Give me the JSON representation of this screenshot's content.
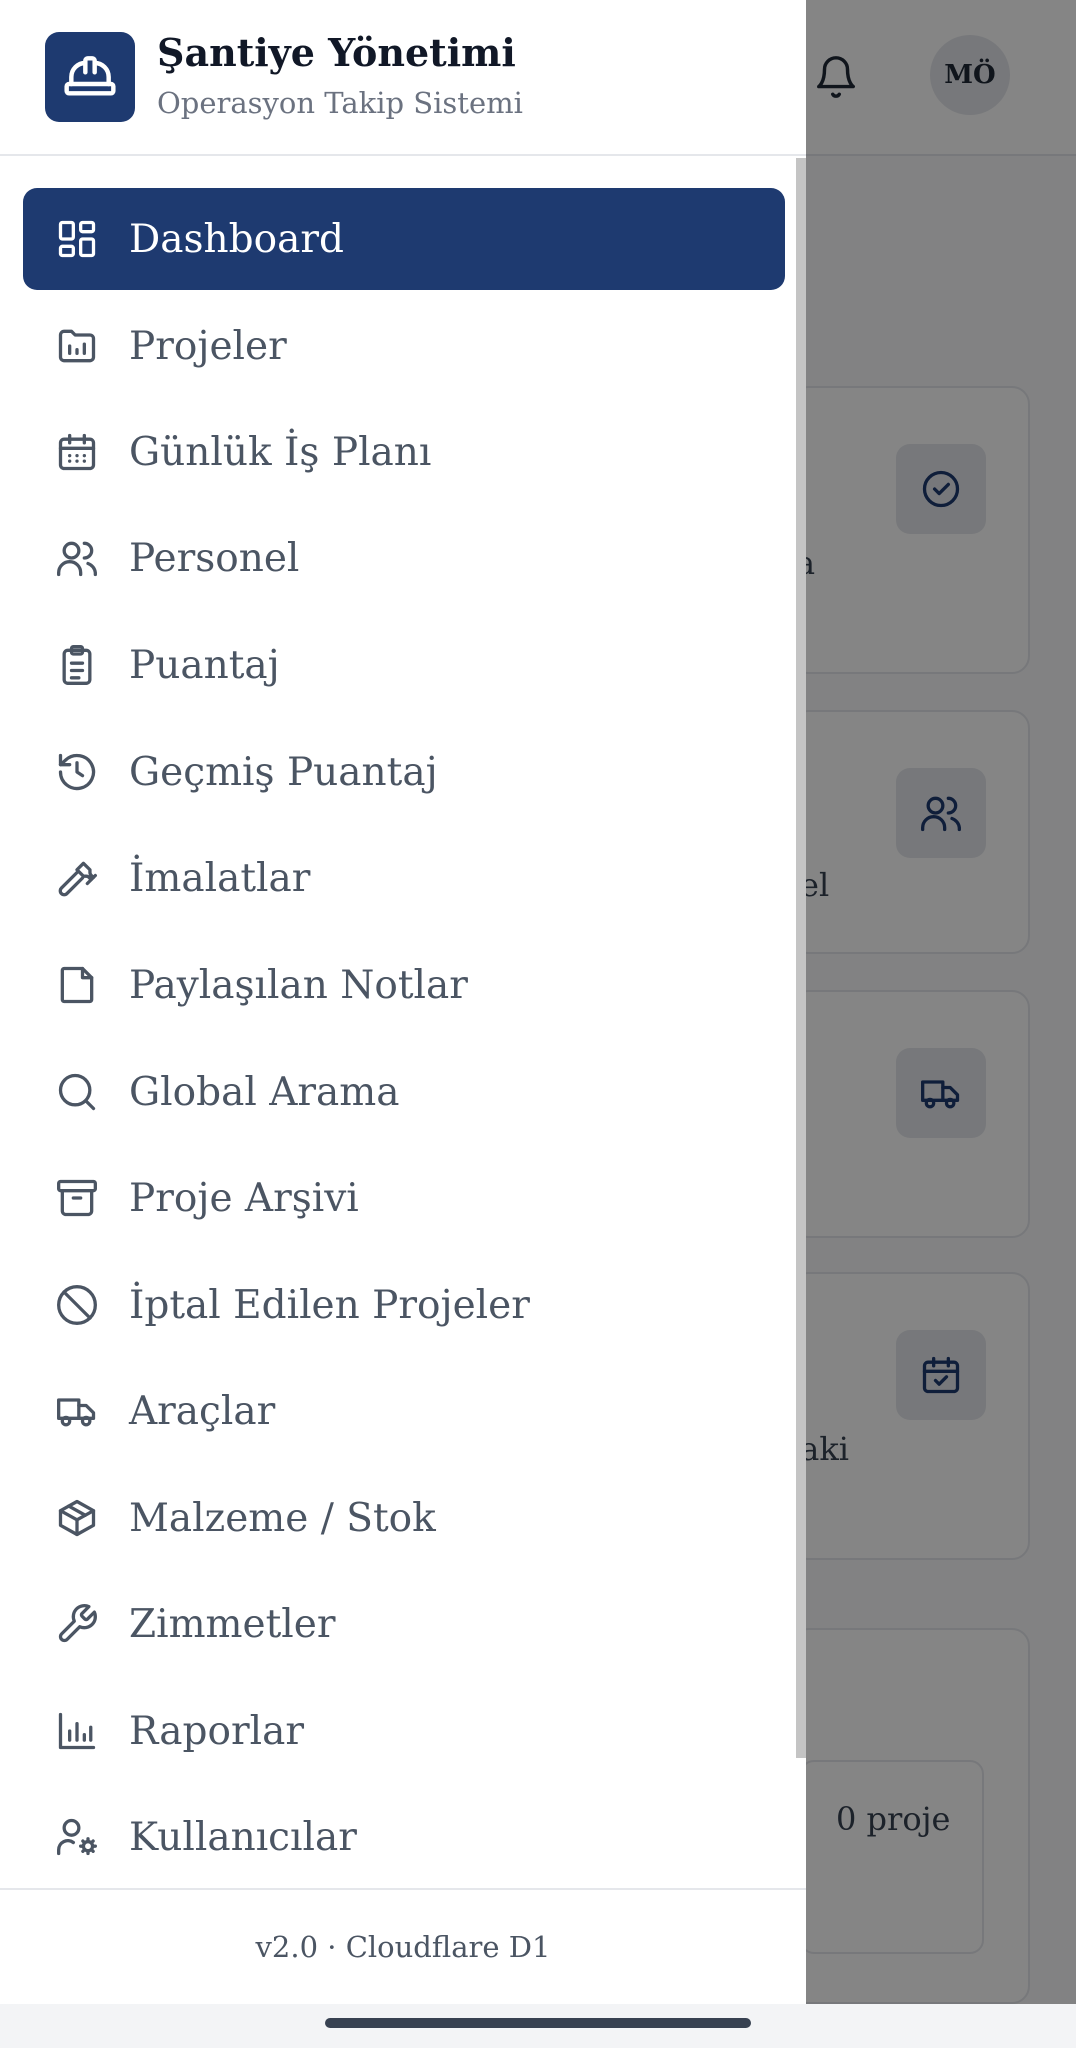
{
  "app": {
    "title": "Şantiye Yönetimi",
    "subtitle": "Operasyon Takip Sistemi",
    "brand_color": "#1e3a70",
    "logo_icon": "hard-hat-icon"
  },
  "header": {
    "avatar_initials": "MÖ",
    "notification_icon": "bell-icon"
  },
  "nav": {
    "items": [
      {
        "label": "Dashboard",
        "icon": "dashboard-icon",
        "active": true
      },
      {
        "label": "Projeler",
        "icon": "folder-chart-icon"
      },
      {
        "label": "Günlük İş Planı",
        "icon": "calendar-icon"
      },
      {
        "label": "Personel",
        "icon": "users-icon"
      },
      {
        "label": "Puantaj",
        "icon": "clipboard-list-icon"
      },
      {
        "label": "Geçmiş Puantaj",
        "icon": "history-icon"
      },
      {
        "label": "İmalatlar",
        "icon": "hammer-icon"
      },
      {
        "label": "Paylaşılan Notlar",
        "icon": "note-icon"
      },
      {
        "label": "Global Arama",
        "icon": "search-icon"
      },
      {
        "label": "Proje Arşivi",
        "icon": "archive-icon"
      },
      {
        "label": "İptal Edilen Projeler",
        "icon": "ban-icon"
      },
      {
        "label": "Araçlar",
        "icon": "truck-icon"
      },
      {
        "label": "Malzeme / Stok",
        "icon": "package-icon"
      },
      {
        "label": "Zimmetler",
        "icon": "wrench-icon"
      },
      {
        "label": "Raporlar",
        "icon": "bar-chart-icon"
      },
      {
        "label": "Kullanıcılar",
        "icon": "user-cog-icon"
      }
    ]
  },
  "footer": {
    "version": "v2.0 · Cloudflare D1"
  },
  "background": {
    "card_fragments": [
      "a",
      "el",
      "laki"
    ],
    "project_count": "0 proje"
  }
}
